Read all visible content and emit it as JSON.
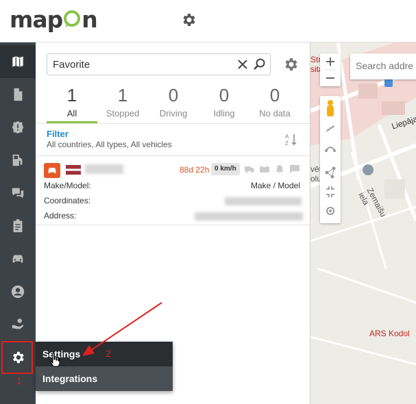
{
  "header": {
    "logo_text": [
      "ma",
      "p",
      "n"
    ],
    "logo_pin_letter": "o",
    "settings_icon": "gear-icon"
  },
  "sidebar": {
    "items": [
      {
        "icon": "map-icon",
        "active": true
      },
      {
        "icon": "document-icon"
      },
      {
        "icon": "alert-icon"
      },
      {
        "icon": "fuel-icon"
      },
      {
        "icon": "chat-icon"
      },
      {
        "icon": "clipboard-icon"
      },
      {
        "icon": "car-icon"
      },
      {
        "icon": "user-icon"
      },
      {
        "icon": "hand-coin-icon"
      },
      {
        "icon": "gear-icon",
        "selected": true
      }
    ]
  },
  "search": {
    "value": "Favorite",
    "placeholder": ""
  },
  "tabs": [
    {
      "count": "1",
      "label": "All",
      "active": true
    },
    {
      "count": "1",
      "label": "Stopped"
    },
    {
      "count": "0",
      "label": "Driving"
    },
    {
      "count": "0",
      "label": "Idling"
    },
    {
      "count": "0",
      "label": "No data"
    }
  ],
  "filter": {
    "title": "Filter",
    "summary": "All countries, All types, All vehicles"
  },
  "vehicle": {
    "time_ago": "88d 22h",
    "speed": "0 km/h",
    "labels": {
      "make_model": "Make/Model:",
      "coordinates": "Coordinates:",
      "address": "Address:"
    },
    "make_model_value": "Make / Model"
  },
  "map": {
    "search_placeholder": "Search addre",
    "labels": {
      "line1": "Stra  a K",
      "line2": "sita  slin",
      "liepaja": "Liepāja",
      "church1": "vēt  erta",
      "church2": "olu  nīca",
      "street": "Zemaišu iela",
      "ars": "ARS Kodol"
    },
    "colors": {
      "red_label": "#c5221f"
    }
  },
  "popup_menu": {
    "items": [
      {
        "label": "Settings"
      },
      {
        "label": "Integrations"
      }
    ]
  },
  "annotations": {
    "step1": "1",
    "step2": "2",
    "color": "#e0201e"
  }
}
